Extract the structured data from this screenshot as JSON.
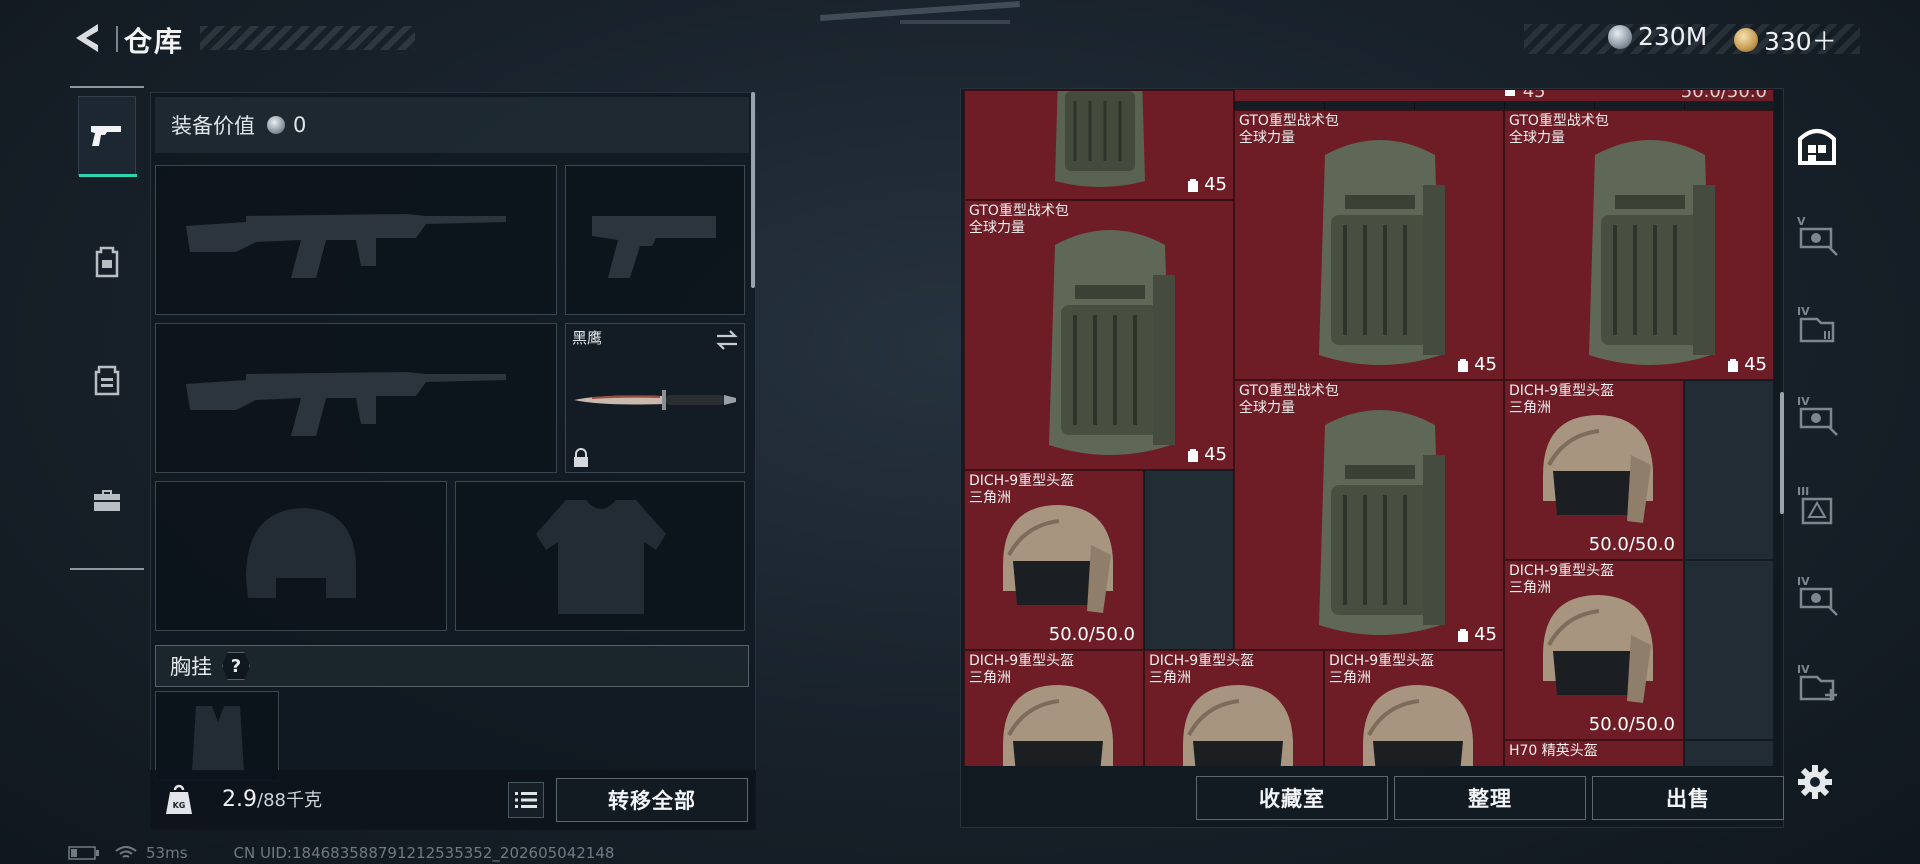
{
  "header": {
    "title": "仓库",
    "currencies": [
      {
        "icon": "silver-coin-icon",
        "value": "230M"
      },
      {
        "icon": "gold-coin-icon",
        "value": "330＋"
      }
    ]
  },
  "categories": [
    {
      "name": "pistol-icon",
      "active": true
    },
    {
      "name": "backpack-icon",
      "active": false
    },
    {
      "name": "vest-icon",
      "active": false
    },
    {
      "name": "toolbox-icon",
      "active": false
    }
  ],
  "loadout": {
    "value_label": "装备价值",
    "value": "0",
    "melee_name": "黑鹰",
    "chest_rig_label": "胸挂",
    "chest_rig_help": "?",
    "weight_current": "2.9",
    "weight_max": "/88千克",
    "transfer_all": "转移全部"
  },
  "storage": {
    "items": [
      {
        "name": "",
        "subtitle": "",
        "badge": "45"
      },
      {
        "name": "GTO重型战术包",
        "subtitle": "全球力量",
        "badge": "45"
      },
      {
        "name": "GTO重型战术包",
        "subtitle": "全球力量",
        "badge": "45"
      },
      {
        "name": "GTO重型战术包",
        "subtitle": "全球力量",
        "badge": "45"
      },
      {
        "name": "GTO重型战术包",
        "subtitle": "全球力量",
        "badge": "45"
      },
      {
        "name": "DICH-9重型头盔",
        "subtitle": "三角洲",
        "durability": "50.0/50.0"
      },
      {
        "name": "DICH-9重型头盔",
        "subtitle": "三角洲",
        "durability": "50.0/50.0"
      },
      {
        "name": "DICH-9重型头盔",
        "subtitle": "三角洲",
        "durability": "50.0/50.0"
      },
      {
        "name": "DICH-9重型头盔",
        "subtitle": "三角洲",
        "durability": ""
      },
      {
        "name": "DICH-9重型头盔",
        "subtitle": "三角洲",
        "durability": ""
      },
      {
        "name": "DICH-9重型头盔",
        "subtitle": "三角洲",
        "durability": ""
      },
      {
        "name": "H70 精英头盔",
        "subtitle": "",
        "durability": ""
      }
    ],
    "partial_top": {
      "badge": "45",
      "durability": "50.0/50.0"
    },
    "actions": [
      "收藏室",
      "整理",
      "出售"
    ],
    "tabs": [
      {
        "name": "storage-home-icon",
        "tier": ""
      },
      {
        "name": "storage-tier-v-icon",
        "tier": "V"
      },
      {
        "name": "storage-tier-iv-a-icon",
        "tier": "IV"
      },
      {
        "name": "storage-tier-iv-b-icon",
        "tier": "IV"
      },
      {
        "name": "storage-tier-iii-icon",
        "tier": "III"
      },
      {
        "name": "storage-tier-iv-c-icon",
        "tier": "IV"
      },
      {
        "name": "storage-tier-iv-d-icon",
        "tier": "IV"
      }
    ]
  },
  "status": {
    "ping": "53ms",
    "uid": "CN UID:1846835887912125353​52_202605042148"
  }
}
